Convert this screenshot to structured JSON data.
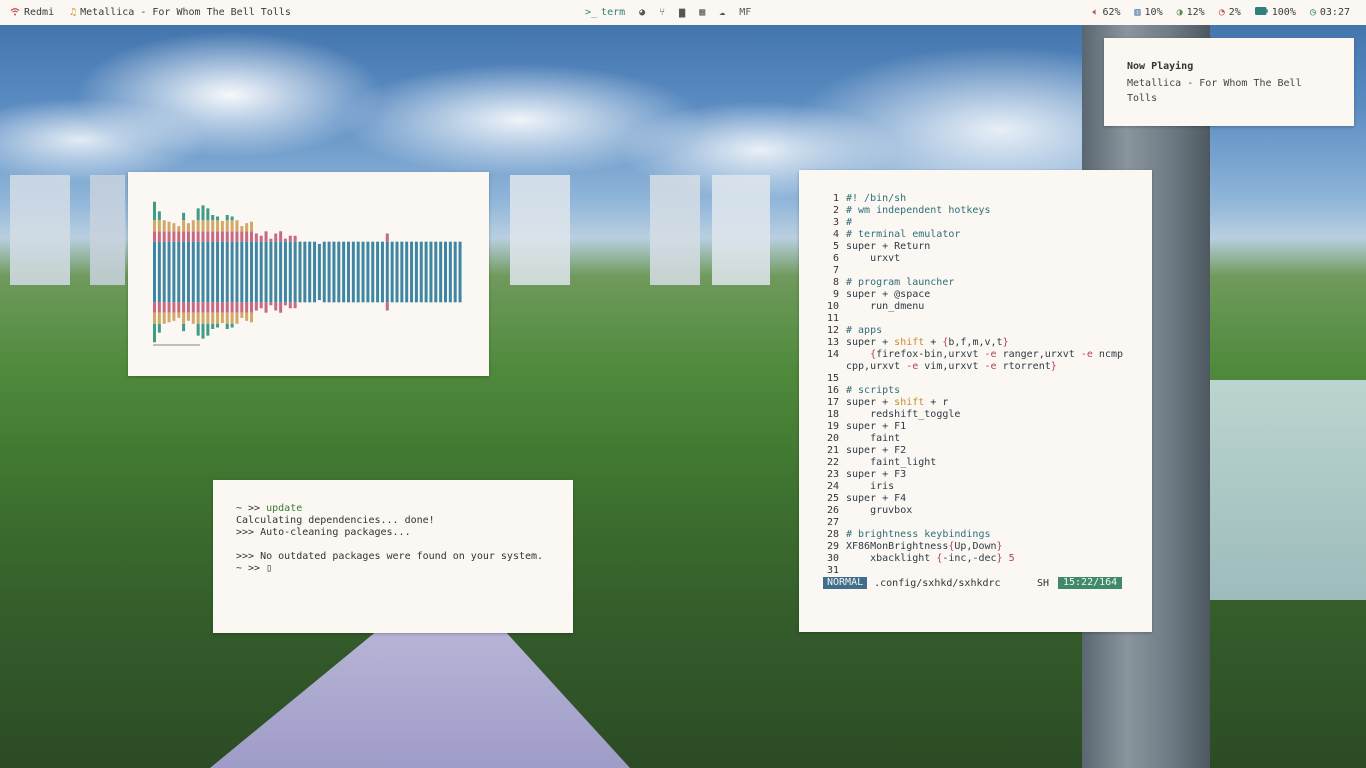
{
  "topbar": {
    "wifi_label": "Redmi",
    "music_label": "Metallica - For Whom The Bell Tolls",
    "workspaces": [
      {
        "icon": "terminal-icon",
        "glyph": ">_",
        "label": "term",
        "active": true
      },
      {
        "icon": "globe-icon",
        "glyph": "◕",
        "label": ""
      },
      {
        "icon": "git-branch-icon",
        "glyph": "⑂",
        "label": ""
      },
      {
        "icon": "folder-icon",
        "glyph": "▆",
        "label": ""
      },
      {
        "icon": "film-icon",
        "glyph": "▦",
        "label": ""
      },
      {
        "icon": "cloud-icon",
        "glyph": "☁",
        "label": ""
      },
      {
        "icon": "",
        "glyph": "",
        "label": "MF"
      }
    ],
    "volume": "62%",
    "memory": "10%",
    "cpu": "12%",
    "disk": "2%",
    "battery": "100%",
    "clock": "03:27"
  },
  "notification": {
    "title": "Now Playing",
    "body": "Metallica - For Whom The Bell Tolls"
  },
  "visualizer": {
    "bars": [
      0.95,
      0.82,
      0.7,
      0.68,
      0.66,
      0.62,
      0.8,
      0.66,
      0.7,
      0.86,
      0.9,
      0.86,
      0.77,
      0.75,
      0.69,
      0.77,
      0.75,
      0.7,
      0.62,
      0.66,
      0.68,
      0.52,
      0.49,
      0.55,
      0.45,
      0.52,
      0.55,
      0.45,
      0.49,
      0.49,
      0.41,
      0.41,
      0.41,
      0.41,
      0.38,
      0.41,
      0.41,
      0.41,
      0.41,
      0.41,
      0.41,
      0.41,
      0.41,
      0.41,
      0.41,
      0.41,
      0.41,
      0.41,
      0.52,
      0.41,
      0.41,
      0.41,
      0.41,
      0.41,
      0.41,
      0.41,
      0.41,
      0.41,
      0.41,
      0.41,
      0.41,
      0.41,
      0.41,
      0.41
    ],
    "colors": {
      "low": "#3f86a3",
      "mid": "#c9687f",
      "high": "#d2a868",
      "top": "#3f9a86"
    }
  },
  "terminal": {
    "lines": [
      {
        "prompt": "~ >> ",
        "cmd": "update"
      },
      {
        "text": "Calculating dependencies... done!"
      },
      {
        "text": ">>> Auto-cleaning packages..."
      },
      {
        "text": ""
      },
      {
        "text": ">>> No outdated packages were found on your system."
      },
      {
        "prompt": "~ >> ",
        "cursor": "▯"
      }
    ]
  },
  "editor": {
    "mode": "NORMAL",
    "file": ".config/sxhkd/sxhkdrc",
    "filetype": "SH",
    "position": "15:22/164",
    "lines": [
      {
        "n": "1",
        "t": "#! /bin/sh",
        "c": "cm"
      },
      {
        "n": "2",
        "t": "# wm independent hotkeys",
        "c": "cm"
      },
      {
        "n": "3",
        "t": "#",
        "c": "cm"
      },
      {
        "n": "4",
        "t": "# terminal emulator",
        "c": "cm"
      },
      {
        "n": "5",
        "t": "super + Return"
      },
      {
        "n": "6",
        "t": "    urxvt"
      },
      {
        "n": "7",
        "t": ""
      },
      {
        "n": "8",
        "t": "# program launcher",
        "c": "cm"
      },
      {
        "n": "9",
        "t": "super + @space"
      },
      {
        "n": "10",
        "t": "    run_dmenu"
      },
      {
        "n": "11",
        "t": ""
      },
      {
        "n": "12",
        "t": "# apps",
        "c": "cm"
      },
      {
        "n": "13",
        "t": "super + shift + {b,f,m,v,t}"
      },
      {
        "n": "14",
        "t": "    {firefox-bin,urxvt -e ranger,urxvt -e ncmpcpp,urxvt -e vim,urxvt -e rtorrent}"
      },
      {
        "n": "15",
        "t": ""
      },
      {
        "n": "16",
        "t": "# scripts",
        "c": "cm"
      },
      {
        "n": "17",
        "t": "super + shift + r"
      },
      {
        "n": "18",
        "t": "    redshift_toggle"
      },
      {
        "n": "19",
        "t": "super + F1"
      },
      {
        "n": "20",
        "t": "    faint"
      },
      {
        "n": "21",
        "t": "super + F2"
      },
      {
        "n": "22",
        "t": "    faint_light"
      },
      {
        "n": "23",
        "t": "super + F3"
      },
      {
        "n": "24",
        "t": "    iris"
      },
      {
        "n": "25",
        "t": "super + F4"
      },
      {
        "n": "26",
        "t": "    gruvbox"
      },
      {
        "n": "27",
        "t": ""
      },
      {
        "n": "28",
        "t": "# brightness keybindings",
        "c": "cm"
      },
      {
        "n": "29",
        "t": "XF86MonBrightness{Up,Down}"
      },
      {
        "n": "30",
        "t": "    xbacklight {-inc,-dec} 5"
      },
      {
        "n": "31",
        "t": ""
      }
    ]
  }
}
